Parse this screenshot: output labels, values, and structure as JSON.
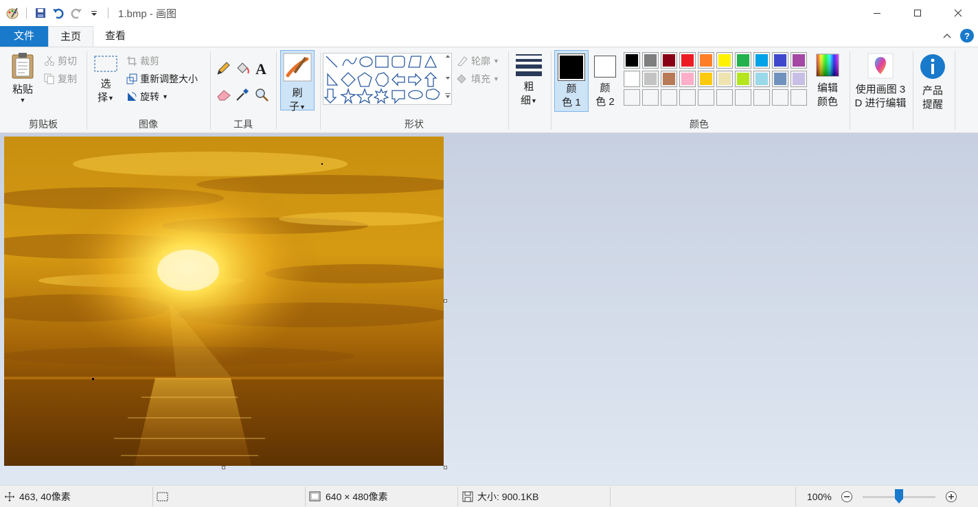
{
  "window": {
    "title": "1.bmp - 画图",
    "controls": [
      "minimize",
      "maximize",
      "close"
    ]
  },
  "tabs": [
    {
      "label": "文件"
    },
    {
      "label": "主页"
    },
    {
      "label": "查看"
    }
  ],
  "ribbon": {
    "clipboard": {
      "paste": "粘贴",
      "cut": "剪切",
      "copy": "复制",
      "group": "剪贴板"
    },
    "image": {
      "select_1": "选",
      "select_2": "择",
      "crop": "裁剪",
      "resize": "重新调整大小",
      "rotate": "旋转",
      "group": "图像"
    },
    "tools": {
      "group": "工具"
    },
    "brushes": {
      "label_1": "刷",
      "label_2": "子"
    },
    "shapes": {
      "outline": "轮廓",
      "fill": "填充",
      "group": "形状"
    },
    "size": {
      "label_1": "粗",
      "label_2": "细"
    },
    "colors": {
      "color1_1": "颜",
      "color1_2": "色 1",
      "color2_1": "颜",
      "color2_2": "色 2",
      "edit_1": "编辑",
      "edit_2": "颜色",
      "group": "颜色",
      "color1_value": "#000000",
      "color2_value": "#ffffff",
      "palette_row1": [
        "#000000",
        "#7f7f7f",
        "#880015",
        "#ed1c24",
        "#ff7f27",
        "#fff200",
        "#22b14c",
        "#00a2e8",
        "#3f48cc",
        "#a349a4"
      ],
      "palette_row2": [
        "#ffffff",
        "#c3c3c3",
        "#b97a57",
        "#ffaec9",
        "#ffc90e",
        "#efe4b0",
        "#b5e61d",
        "#99d9ea",
        "#7092be",
        "#c8bfe7"
      ],
      "palette_row3": [
        "#f5f6f7",
        "#f5f6f7",
        "#f5f6f7",
        "#f5f6f7",
        "#f5f6f7",
        "#f5f6f7",
        "#f5f6f7",
        "#f5f6f7",
        "#f5f6f7",
        "#f5f6f7"
      ]
    },
    "paint3d": {
      "label_1": "使用画图 3",
      "label_2": "D 进行编辑"
    },
    "product": {
      "label_1": "产品",
      "label_2": "提醒"
    }
  },
  "status": {
    "cursor": "463, 40像素",
    "dimensions": "640 × 480像素",
    "size": "大小: 900.1KB",
    "zoom": "100%",
    "zoom_slider_value": 0.5
  }
}
